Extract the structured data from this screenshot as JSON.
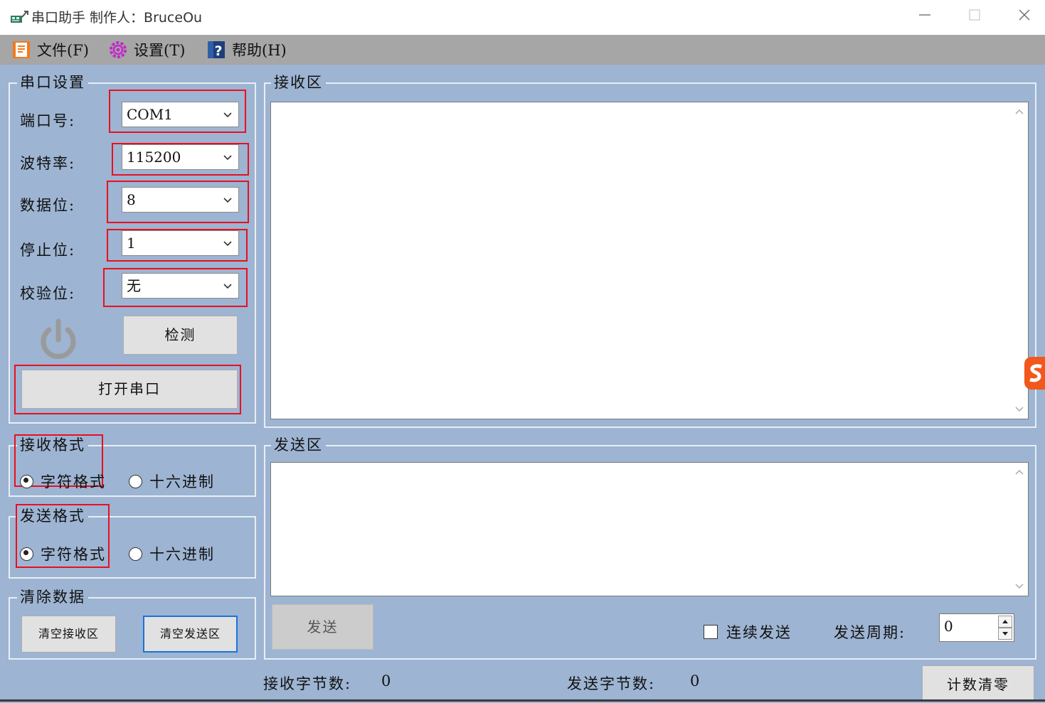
{
  "window": {
    "title": "串口助手 制作人：BruceOu"
  },
  "menu": {
    "file": "文件(F)",
    "settings": "设置(T)",
    "help": "帮助(H)"
  },
  "serial_settings": {
    "title": "串口设置",
    "port_label": "端口号:",
    "port_value": "COM1",
    "baud_label": "波特率:",
    "baud_value": "115200",
    "data_bits_label": "数据位:",
    "data_bits_value": "8",
    "stop_bits_label": "停止位:",
    "stop_bits_value": "1",
    "parity_label": "校验位:",
    "parity_value": "无",
    "detect_button": "检测",
    "open_button": "打开串口"
  },
  "receive_format": {
    "title": "接收格式",
    "char": "字符格式",
    "hex": "十六进制",
    "selected": "char"
  },
  "send_format": {
    "title": "发送格式",
    "char": "字符格式",
    "hex": "十六进制",
    "selected": "char"
  },
  "clear_data": {
    "title": "清除数据",
    "clear_receive": "清空接收区",
    "clear_send": "清空发送区"
  },
  "receive_area": {
    "title": "接收区",
    "content": ""
  },
  "send_area": {
    "title": "发送区",
    "content": "",
    "send_button": "发送",
    "continuous_label": "连续发送",
    "continuous_checked": false,
    "period_label": "发送周期:",
    "period_value": "0"
  },
  "status": {
    "rx_label": "接收字节数:",
    "rx_value": "0",
    "tx_label": "发送字节数:",
    "tx_value": "0",
    "reset_button": "计数清零"
  },
  "colors": {
    "window_bg": "#9db4d2",
    "highlight_red": "#e8101f",
    "menu_bg": "#a6a6a6"
  }
}
